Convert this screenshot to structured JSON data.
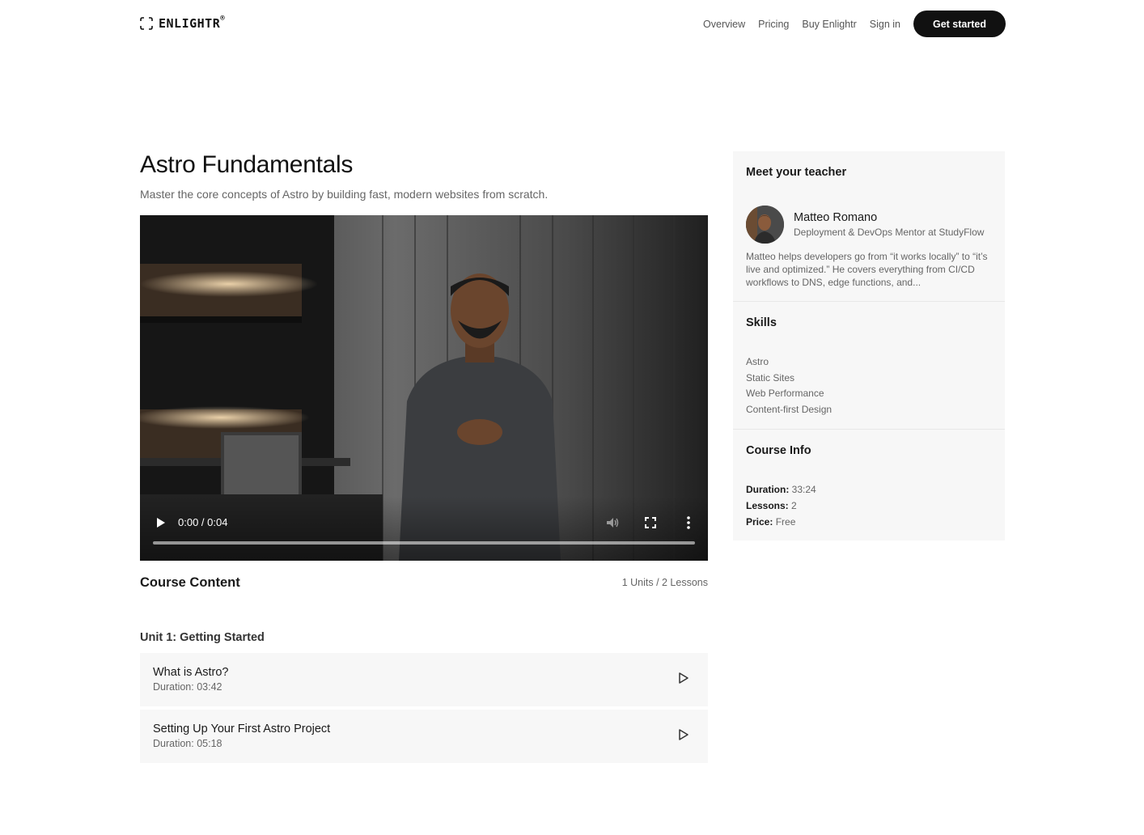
{
  "header": {
    "logo_text": "ENLIGHTR",
    "logo_reg": "®",
    "nav": [
      "Overview",
      "Pricing",
      "Buy Enlightr",
      "Sign in"
    ],
    "cta_label": "Get started"
  },
  "course": {
    "title": "Astro Fundamentals",
    "subtitle": "Master the core concepts of Astro by building fast, modern websites from scratch."
  },
  "video": {
    "time": "0:00 / 0:04",
    "progress": 0
  },
  "content": {
    "heading": "Course Content",
    "count": "1 Units / 2 Lessons",
    "units": [
      {
        "title": "Unit 1: Getting Started",
        "lessons": [
          {
            "title": "What is Astro?",
            "duration": "Duration: 03:42"
          },
          {
            "title": "Setting Up Your First Astro Project",
            "duration": "Duration: 05:18"
          }
        ]
      }
    ]
  },
  "teacher": {
    "heading": "Meet your teacher",
    "name": "Matteo Romano",
    "role": "Deployment & DevOps Mentor at StudyFlow",
    "bio": "Matteo helps developers go from “it works locally” to “it’s live and optimized.” He covers everything from CI/CD workflows to DNS, edge functions, and..."
  },
  "skills": {
    "heading": "Skills",
    "items": [
      "Astro",
      "Static Sites",
      "Web Performance",
      "Content-first Design"
    ]
  },
  "info": {
    "heading": "Course Info",
    "items": [
      {
        "label": "Duration:",
        "value": "33:24"
      },
      {
        "label": "Lessons:",
        "value": "2"
      },
      {
        "label": "Price:",
        "value": "Free"
      }
    ]
  }
}
